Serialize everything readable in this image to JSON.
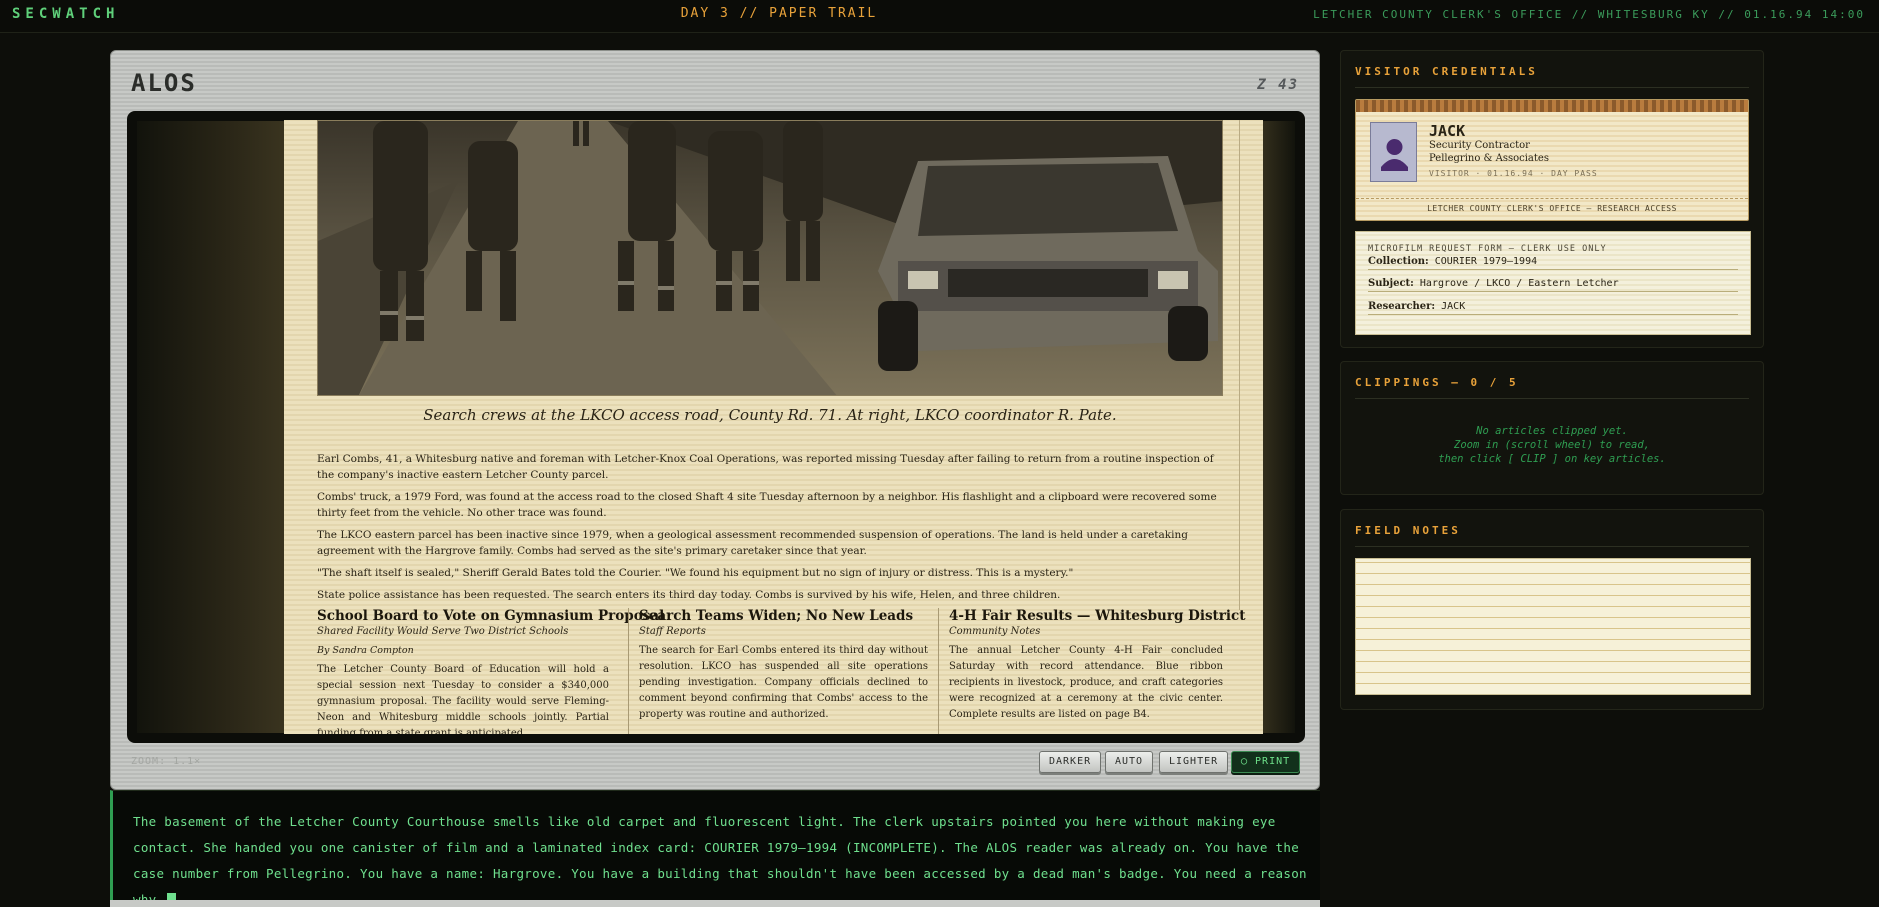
{
  "header": {
    "brand": "SECWATCH",
    "day": "DAY 3 // PAPER TRAIL",
    "location": "LETCHER COUNTY CLERK'S OFFICE // WHITESBURG KY // 01.16.94 14:00"
  },
  "reader": {
    "title": "ALOS",
    "frame_code": "Z 43",
    "zoom_label": "ZOOM: 1.1×",
    "controls": {
      "darker": "DARKER",
      "auto": "AUTO",
      "lighter": "LIGHTER",
      "print": "◯ PRINT"
    }
  },
  "article": {
    "caption": "Search crews at the LKCO access road, County Rd. 71. At right, LKCO coordinator R. Pate.",
    "paragraphs": [
      "Earl Combs, 41, a Whitesburg native and foreman with Letcher-Knox Coal Operations, was reported missing Tuesday after failing to return from a routine inspection of the company's inactive eastern Letcher County parcel.",
      "Combs' truck, a 1979 Ford, was found at the access road to the closed Shaft 4 site Tuesday afternoon by a neighbor. His flashlight and a clipboard were recovered some thirty feet from the vehicle. No other trace was found.",
      "The LKCO eastern parcel has been inactive since 1979, when a geological assessment recommended suspension of operations. The land is held under a caretaking agreement with the Hargrove family. Combs had served as the site's primary caretaker since that year.",
      "\"The shaft itself is sealed,\" Sheriff Gerald Bates told the Courier. \"We found his equipment but no sign of injury or distress. This is a mystery.\"",
      "State police assistance has been requested. The search enters its third day today. Combs is survived by his wife, Helen, and three children."
    ],
    "columns": [
      {
        "headline": "School Board to Vote on Gymnasium Proposal",
        "deck": "Shared Facility Would Serve Two District Schools",
        "byline": "By Sandra Compton",
        "text": "The Letcher County Board of Education will hold a special session next Tuesday to consider a $340,000 gymnasium proposal. The facility would serve Fleming-Neon and Whitesburg middle schools jointly. Partial funding from a state grant is anticipated."
      },
      {
        "headline": "Search Teams Widen; No New Leads",
        "deck": "Staff Reports",
        "byline": "",
        "text": "The search for Earl Combs entered its third day without resolution. LKCO has suspended all site operations pending investigation. Company officials declined to comment beyond confirming that Combs' access to the property was routine and authorized."
      },
      {
        "headline": "4-H Fair Results — Whitesburg District",
        "deck": "Community Notes",
        "byline": "",
        "text": "The annual Letcher County 4-H Fair concluded Saturday with record attendance. Blue ribbon recipients in livestock, produce, and craft categories were recognized at a ceremony at the civic center. Complete results are listed on page B4."
      }
    ]
  },
  "narrative": {
    "text": "The basement of the Letcher County Courthouse smells like old carpet and fluorescent light. The clerk upstairs pointed you here without making eye contact. She handed you one canister of film and a laminated index card: COURIER 1979–1994 (INCOMPLETE). The ALOS reader was already on. You have the case number from Pellegrino. You have a name: Hargrove. You have a building that shouldn't have been accessed by a dead man's badge. You need a reason why."
  },
  "credentials": {
    "title": "VISITOR CREDENTIALS",
    "badge": {
      "name": "JACK",
      "role": "Security Contractor",
      "org": "Pellegrino & Associates",
      "visitor": "VISITOR · 01.16.94 · DAY PASS",
      "footer": "LETCHER COUNTY CLERK'S OFFICE — RESEARCH ACCESS"
    },
    "form": {
      "heading": "MICROFILM REQUEST FORM — CLERK USE ONLY",
      "collection_label": "Collection:",
      "collection": "COURIER 1979–1994",
      "subject_label": "Subject:",
      "subject": "Hargrove / LKCO / Eastern Letcher",
      "researcher_label": "Researcher:",
      "researcher": "JACK"
    }
  },
  "clippings": {
    "title": "CLIPPINGS — 0 / 5",
    "empty_1": "No articles clipped yet.",
    "empty_2": "Zoom in (scroll wheel) to read,",
    "empty_3": "then click [ CLIP ] on key articles."
  },
  "field_notes": {
    "title": "FIELD NOTES"
  },
  "colors": {
    "accent_amber": "#e8a23a",
    "terminal_green": "#6fe08e",
    "paper": "#ece1bd"
  }
}
